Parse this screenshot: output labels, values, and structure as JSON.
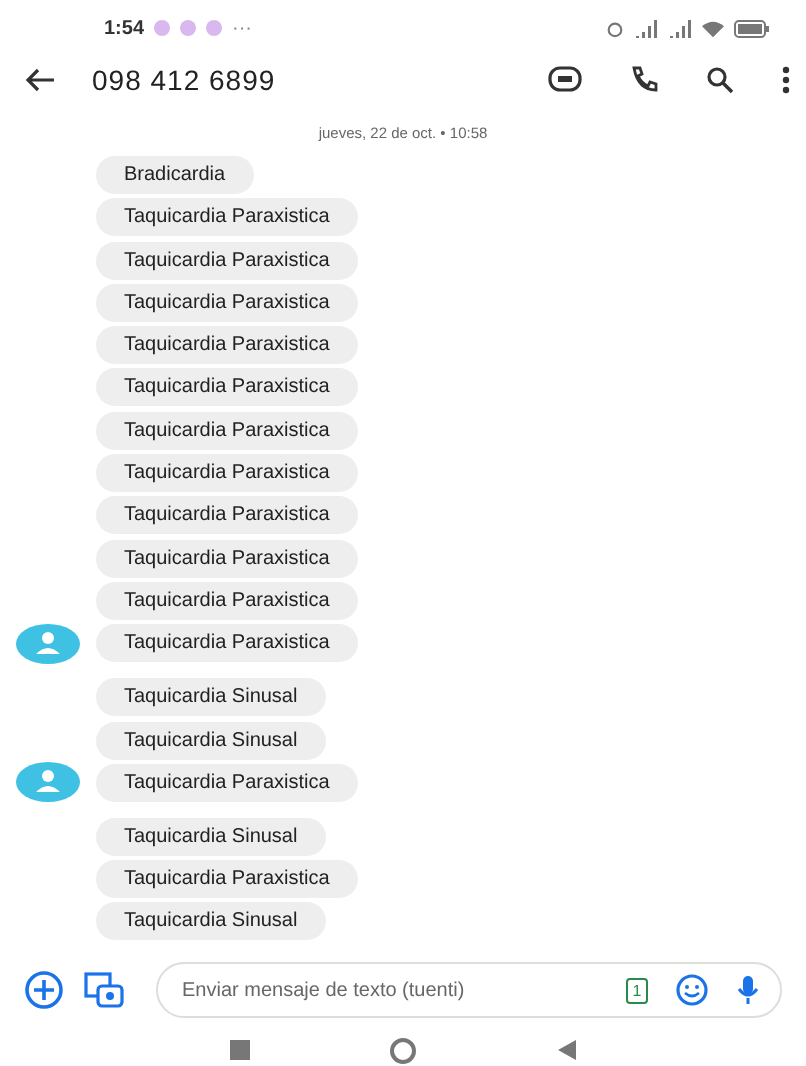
{
  "status_bar": {
    "time": "1:54",
    "more": "···"
  },
  "header": {
    "title": "098 412 6899"
  },
  "date_divider": "jueves, 22 de oct. • 10:58",
  "groups": [
    {
      "show_avatar": true,
      "messages": [
        "Bradicardia",
        "Taquicardia Paraxistica",
        "Taquicardia Paraxistica",
        "Taquicardia Paraxistica",
        "Taquicardia Paraxistica",
        "Taquicardia Paraxistica",
        "Taquicardia Paraxistica",
        "Taquicardia Paraxistica",
        "Taquicardia Paraxistica",
        "Taquicardia Paraxistica",
        "Taquicardia Paraxistica",
        "Taquicardia Paraxistica"
      ]
    },
    {
      "show_avatar": true,
      "messages": [
        "Taquicardia Sinusal",
        "Taquicardia Sinusal",
        "Taquicardia Paraxistica"
      ]
    },
    {
      "show_avatar": false,
      "messages": [
        "Taquicardia Sinusal",
        "Taquicardia Paraxistica",
        "Taquicardia Sinusal"
      ]
    }
  ],
  "compose": {
    "placeholder": "Enviar mensaje de texto (tuenti)",
    "sim_label": "1"
  }
}
